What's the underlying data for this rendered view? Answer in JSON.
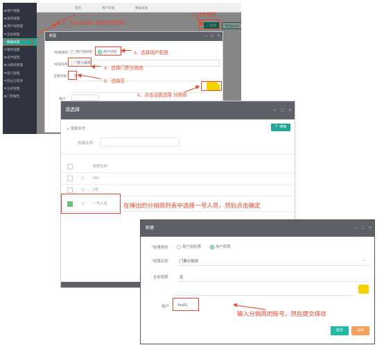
{
  "screen1": {
    "sidebar": [
      "用户管理",
      "角色管理",
      "用户组管理",
      "菜单管理",
      "数据权限",
      "服务设置",
      "组件管理",
      "分销商管理",
      "部门管理",
      "岗位与职责",
      "任务管理",
      "门禁报告"
    ],
    "active_index": 4,
    "tabs": [
      "首页",
      "用户权限",
      "数据权限"
    ],
    "add_button": "+ 新增",
    "other_button": "导出Excel",
    "dialog": {
      "title": "新建",
      "type_label": "*权限类别",
      "type_options": [
        "用户组权限",
        "用户权限"
      ],
      "name_label": "*权限名称",
      "name_value": "门票分销商",
      "all_label": "全部权限",
      "all_value": "否",
      "user_label": "用户"
    },
    "callouts": {
      "c1": "1、点击设置进入数据权限页面",
      "c2": "2、点击新增",
      "c3": "3、选择用户权限",
      "c4": "4、选择门票分销商",
      "c5": "5、选择否",
      "c6": "6、点击设置选择 分销商"
    }
  },
  "screen2": {
    "title": "请选择",
    "search_header": "搜索条件",
    "search_button": "搜索",
    "search_field_label": "权限名称:",
    "column_header": "权限名称",
    "rows": [
      {
        "index": "1",
        "name": "003",
        "checked": false
      },
      {
        "index": "2",
        "name": "2号",
        "checked": false
      },
      {
        "index": "3",
        "name": "一号人员",
        "checked": true
      }
    ],
    "callout": "在弹出的分销商列表中选择一号人员，然后点击确定"
  },
  "screen3": {
    "title": "新建",
    "type_label": "*权限类别",
    "type_options": [
      "用户组权限",
      "用户权限"
    ],
    "name_label": "*权限名称",
    "name_value": "门票分销商",
    "all_label": "全部权限",
    "all_value": "否",
    "user_label": "用户",
    "user_value": "fxs01",
    "submit": "提交",
    "close": "关闭",
    "callout": "输入分销商的账号，然后提交保存"
  },
  "colors": {
    "teal": "#1fa896",
    "red": "#e8452c",
    "yellow": "#f4d200",
    "orange": "#f4a05a"
  }
}
